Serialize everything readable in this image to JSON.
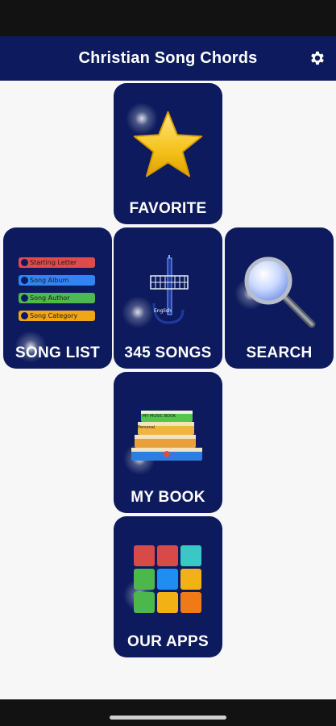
{
  "app_bar": {
    "title": "Christian Song Chords",
    "settings_icon": "gear-icon"
  },
  "tiles": {
    "favorite": {
      "label": "FAVORITE",
      "icon": "star-icon"
    },
    "song_list": {
      "label": "SONG LIST",
      "icon": "list-icon",
      "pills": [
        {
          "text": "Starting Letter",
          "color": "#e04a4a"
        },
        {
          "text": "Song Album",
          "color": "#2f86f2"
        },
        {
          "text": "Song Author",
          "color": "#4cba4c"
        },
        {
          "text": "Song Category",
          "color": "#f2a516"
        }
      ]
    },
    "songs": {
      "label": "345 SONGS",
      "icon": "guitar-icon",
      "small_text": "English"
    },
    "search": {
      "label": "SEARCH",
      "icon": "magnifier-icon"
    },
    "my_book": {
      "label": "MY BOOK",
      "icon": "books-icon",
      "book_texts": [
        "MY MUSIC BOOK",
        "Personal"
      ]
    },
    "our_apps": {
      "label": "OUR APPS",
      "icon": "app-grid-icon",
      "squares": [
        "#d84a4a",
        "#d84a4a",
        "#3cc7c7",
        "#4cb84c",
        "#1f8ef0",
        "#f2b216",
        "#4cb84c",
        "#f2b216",
        "#f27a16"
      ]
    }
  },
  "colors": {
    "primary": "#0d1b5e",
    "background": "#f7f7f8",
    "system_bar": "#121212"
  }
}
